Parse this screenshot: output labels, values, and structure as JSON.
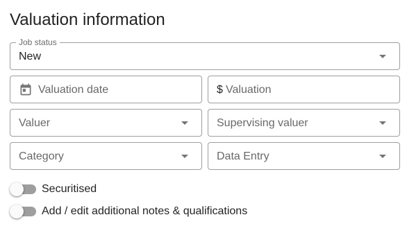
{
  "section_title": "Valuation information",
  "job_status": {
    "label": "Job status",
    "value": "New"
  },
  "valuation_date": {
    "placeholder": "Valuation date",
    "icon": "calendar-icon"
  },
  "valuation": {
    "prefix": "$",
    "placeholder": "Valuation"
  },
  "valuer": {
    "placeholder": "Valuer"
  },
  "supervising_valuer": {
    "placeholder": "Supervising valuer"
  },
  "category": {
    "placeholder": "Category"
  },
  "data_entry": {
    "placeholder": "Data Entry"
  },
  "toggles": [
    {
      "label": "Securitised",
      "on": false
    },
    {
      "label": "Add / edit additional notes & qualifications",
      "on": false
    }
  ]
}
